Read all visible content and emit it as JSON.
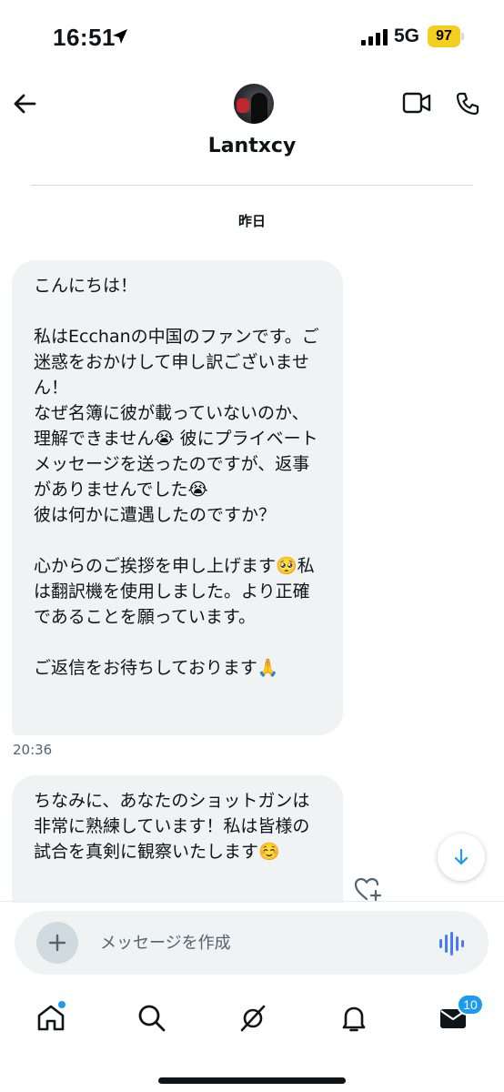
{
  "status_bar": {
    "time": "16:51",
    "network": "5G",
    "battery": "97",
    "battery_color": "#f5cf1e"
  },
  "header": {
    "contact_name": "Lantxcy",
    "back_icon": "arrow-left-icon",
    "video_icon": "video-camera-icon",
    "phone_icon": "phone-icon"
  },
  "conversation": {
    "date_separator": "昨日",
    "messages": [
      {
        "text": "こんにちは！\n\n私はEcchanの中国のファンです。ご迷惑をおかけして申し訳ございません！\nなぜ名簿に彼が載っていないのか、理解できません😭 彼にプライベートメッセージを送ったのですが、返事がありませんでした😭\n彼は何かに遭遇したのですか？\n\n心からのご挨拶を申し上げます🥺私は翻訳機を使用しました。より正確であることを願っています。\n\nご返信をお待ちしております🙏",
        "time": "20:36"
      },
      {
        "text": "ちなみに、あなたのショットガンは非常に熟練しています！私は皆様の試合を真剣に観察いたします☺️"
      }
    ]
  },
  "composer": {
    "placeholder": "メッセージを作成",
    "add_icon": "plus-icon",
    "voice_icon": "voice-waveform-icon"
  },
  "tab_bar": {
    "tabs": [
      "home",
      "search",
      "grok",
      "notifications",
      "messages"
    ],
    "messages_badge": "10",
    "accent_color": "#1d9bf0"
  }
}
